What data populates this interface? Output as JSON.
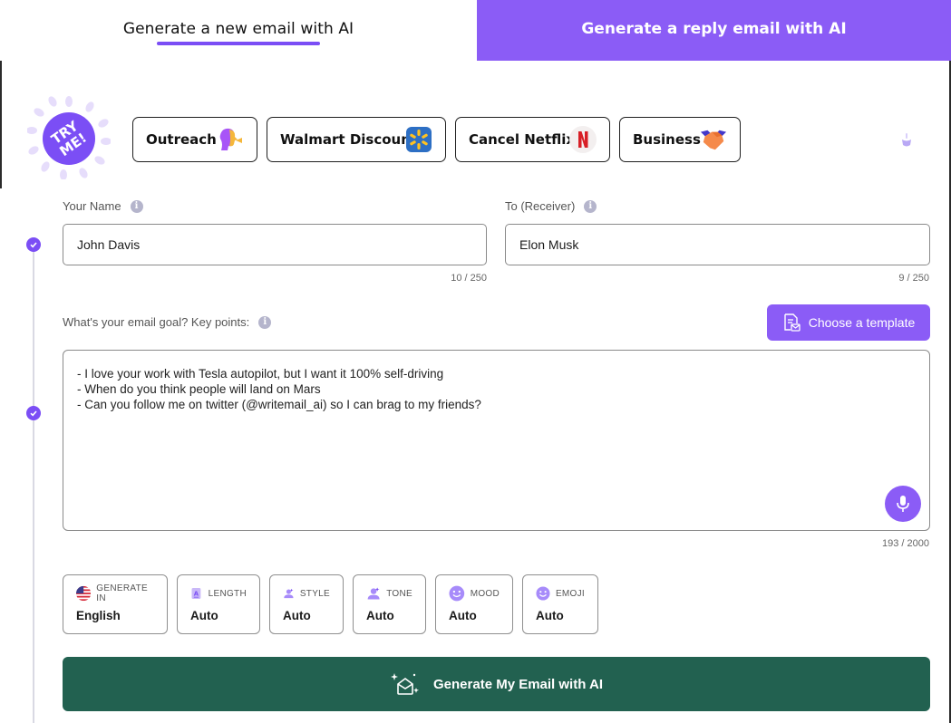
{
  "tabs": {
    "active": "Generate a new email with AI",
    "inactive": "Generate a reply email with AI"
  },
  "tryme": {
    "text_line1": "TRY",
    "text_line2": "ME!",
    "color": "#7b4ef5"
  },
  "presets": [
    {
      "label": "Outreach",
      "icon": "person-outreach-icon"
    },
    {
      "label": "Walmart Discount",
      "icon": "walmart-spark-icon"
    },
    {
      "label": "Cancel Netflix",
      "icon": "netflix-icon"
    },
    {
      "label": "Business",
      "icon": "handshake-icon"
    }
  ],
  "form": {
    "name_label": "Your Name",
    "name_value": "John Davis",
    "name_counter": "10 / 250",
    "receiver_label": "To (Receiver)",
    "receiver_value": "Elon Musk",
    "receiver_counter": "9 / 250",
    "goal_label": "What's your email goal? Key points:",
    "template_button": "Choose a template",
    "goal_lines": [
      "- I love your work with Tesla autopilot, but I want it 100% self-driving",
      "- When do you think people will land on Mars",
      "- Can you follow me on twitter (@writemail_ai) so I can brag to my friends?"
    ],
    "goal_counter": "193 / 2000"
  },
  "options": [
    {
      "title": "GENERATE IN",
      "value": "English",
      "icon": "us-flag-icon"
    },
    {
      "title": "LENGTH",
      "value": "Auto",
      "icon": "length-icon"
    },
    {
      "title": "STYLE",
      "value": "Auto",
      "icon": "style-person-icon"
    },
    {
      "title": "TONE",
      "value": "Auto",
      "icon": "tone-person-icon"
    },
    {
      "title": "MOOD",
      "value": "Auto",
      "icon": "smiley-icon"
    },
    {
      "title": "EMOJI",
      "value": "Auto",
      "icon": "emoji-icon"
    }
  ],
  "generate_button": "Generate My Email with AI",
  "colors": {
    "accent": "#8b5cf6",
    "accent_dark": "#7b4ef5",
    "generate": "#226150"
  }
}
